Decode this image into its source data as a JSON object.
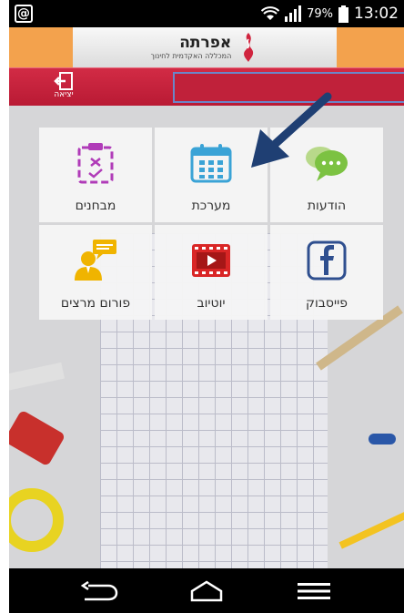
{
  "status_bar": {
    "notification_glyph": "@",
    "battery_percent": "79%",
    "time": "13:02"
  },
  "header": {
    "logo_title": "אפרתה",
    "logo_subtitle": "המכללה האקדמית לחינוך",
    "accent_color": "#f3a24d"
  },
  "toolbar": {
    "exit_label": "יציאה",
    "bar_color": "#c8223d"
  },
  "menu": {
    "tiles": [
      {
        "label": "הודעות",
        "icon": "chat-bubble-icon",
        "color": "#7cc242"
      },
      {
        "label": "מערכת",
        "icon": "calendar-icon",
        "color": "#3aa3d6"
      },
      {
        "label": "מבחנים",
        "icon": "clipboard-check-icon",
        "color": "#b03bb8"
      },
      {
        "label": "פייסבוק",
        "icon": "facebook-icon",
        "color": "#2f4f8f"
      },
      {
        "label": "יוטיוב",
        "icon": "video-icon",
        "color": "#d92626"
      },
      {
        "label": "פורום מרצים",
        "icon": "lecturer-forum-icon",
        "color": "#f0b400"
      }
    ]
  },
  "nav": {
    "back": "back-icon",
    "home": "home-icon",
    "menu": "menu-icon"
  },
  "annotation": {
    "arrow_color": "#1f3f73"
  }
}
